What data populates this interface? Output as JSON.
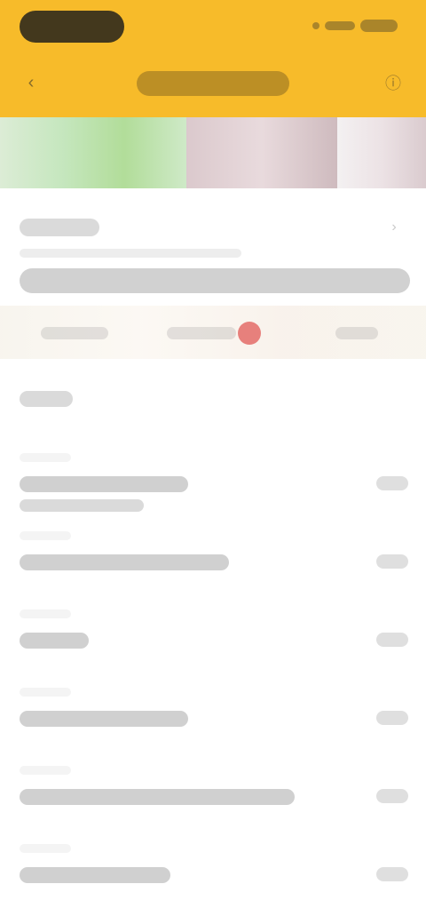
{
  "header": {
    "back_icon": "chevron-left-icon",
    "right_icon": "info-icon"
  },
  "banner": {
    "colors": [
      "#bfe4b7",
      "#d7c3c7",
      "#eadfe2"
    ]
  },
  "card": {
    "right_icon": "chevron-right-icon"
  },
  "list": {
    "rows": [
      {},
      {},
      {},
      {},
      {},
      {}
    ]
  },
  "colors": {
    "header_bg": "#F7BB2A",
    "badge_red": "#E05A55"
  }
}
